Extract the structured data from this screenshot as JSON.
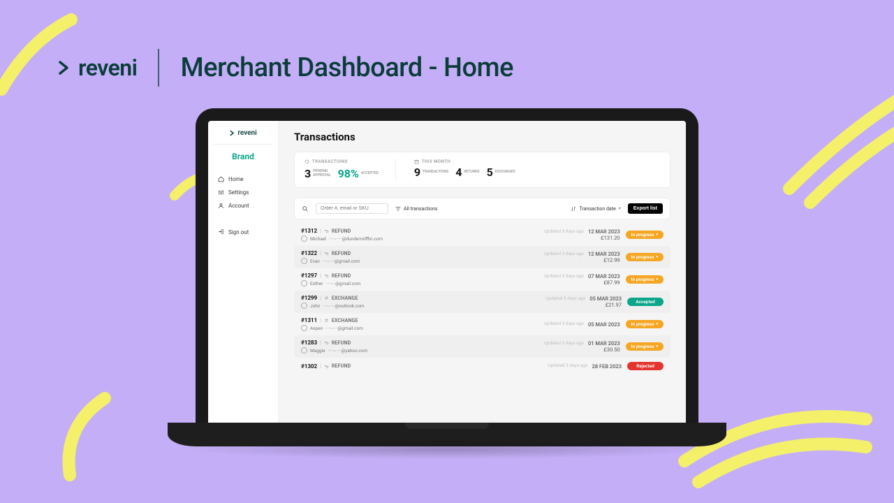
{
  "header": {
    "brand": "reveni",
    "title": "Merchant Dashboard - Home"
  },
  "sidebar": {
    "logo": "reveni",
    "brand_label": "Brand",
    "items": [
      {
        "icon": "home-icon",
        "label": "Home"
      },
      {
        "icon": "sliders-icon",
        "label": "Settings"
      },
      {
        "icon": "user-icon",
        "label": "Account"
      }
    ],
    "signout_label": "Sign out"
  },
  "main": {
    "title": "Transactions",
    "stats": {
      "transactions_label": "TRANSACTIONS",
      "pending_value": "3",
      "pending_sub": "PENDING\nAPPROVAL",
      "accepted_pct": "98%",
      "accepted_sub": "ACCEPTED",
      "month_label": "THIS MONTH",
      "month_tx_value": "9",
      "month_tx_sub": "TRANSACTIONS",
      "month_ret_value": "4",
      "month_ret_sub": "RETURNS",
      "month_ex_value": "5",
      "month_ex_sub": "EXCHANGES"
    },
    "toolbar": {
      "search_placeholder": "Order #, email or SKU",
      "filter_label": "All transactions",
      "sort_label": "Transaction date",
      "export_label": "Export list"
    },
    "transactions": [
      {
        "id": "#1312",
        "type": "REFUND",
        "name": "Michael",
        "email_masked": "·····-·····@dundermifflin.com",
        "updated": "Updated 3 days ago",
        "date": "12 MAR 2023",
        "amount": "£131.20",
        "status": "In progress",
        "status_kind": "progress"
      },
      {
        "id": "#1322",
        "type": "REFUND",
        "name": "Evan",
        "email_masked": "····-·····@gmail.com",
        "updated": "Updated 3 days ago",
        "date": "12 MAR 2023",
        "amount": "£12.99",
        "status": "In progress",
        "status_kind": "progress"
      },
      {
        "id": "#1297",
        "type": "REFUND",
        "name": "Esther",
        "email_masked": "·····-··@gmail.com",
        "updated": "Updated 3 days ago",
        "date": "07 MAR 2023",
        "amount": "£87.99",
        "status": "In progress",
        "status_kind": "progress"
      },
      {
        "id": "#1299",
        "type": "EXCHANGE",
        "name": "John",
        "email_masked": "····-·····@outlook.com",
        "updated": "Updated 3 days ago",
        "date": "05 MAR 2023",
        "amount": "£21.97",
        "status": "Accepted",
        "status_kind": "accepted"
      },
      {
        "id": "#1311",
        "type": "EXCHANGE",
        "name": "Aspen",
        "email_masked": "·····-····@gmail.com",
        "updated": "Updated 3 days ago",
        "date": "05 MAR 2023",
        "amount": "",
        "status": "In progress",
        "status_kind": "progress"
      },
      {
        "id": "#1283",
        "type": "REFUND",
        "name": "Maggie",
        "email_masked": "·····-·····@yahoo.com",
        "updated": "Updated 3 days ago",
        "date": "01 MAR 2023",
        "amount": "£30.50",
        "status": "In progress",
        "status_kind": "progress"
      },
      {
        "id": "#1302",
        "type": "REFUND",
        "name": "",
        "email_masked": "",
        "updated": "Updated 3 days ago",
        "date": "28 FEB 2023",
        "amount": "",
        "status": "Rejected",
        "status_kind": "rejected"
      }
    ]
  }
}
